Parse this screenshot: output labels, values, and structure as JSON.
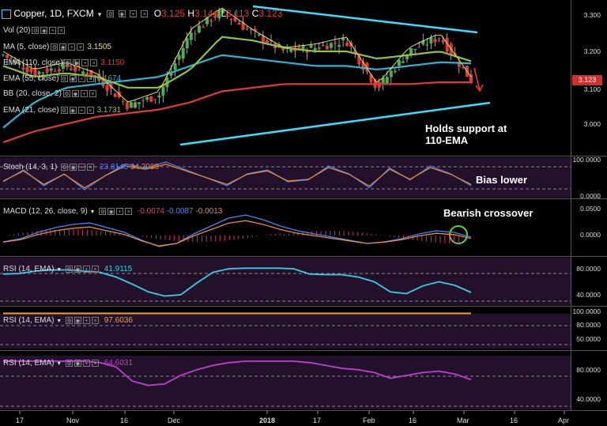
{
  "header": {
    "symbol": "Copper, 1D, FXCM",
    "open_label": "O",
    "open": "3.125",
    "high_label": "H",
    "high": "3.144",
    "low_label": "L",
    "low": "3.113",
    "close_label": "C",
    "close": "3.123"
  },
  "price_panel": {
    "indicators": [
      {
        "label": "Vol (20)",
        "value": "",
        "color": "#dddddd"
      },
      {
        "label": "MA (5, close)",
        "value": "3.1505",
        "color": "#e8e05a"
      },
      {
        "label": "EMA (110, close)",
        "value": "3.1150",
        "color": "#e53935"
      },
      {
        "label": "EMA (55, close)",
        "value": "3.1674",
        "color": "#29b6d6"
      },
      {
        "label": "BB (20, close, 2)",
        "value": "",
        "color": "#dddddd"
      },
      {
        "label": "EMA (21, close)",
        "value": "3.1731",
        "color": "#8bc34a"
      }
    ],
    "current_price": "3.123",
    "axis": [
      "3.300",
      "3.200",
      "3.100",
      "3.000"
    ]
  },
  "annotations": {
    "support": "Holds support at\n110-EMA",
    "bias": "Bias lower",
    "crossover": "Bearish crossover"
  },
  "stoch_panel": {
    "label": "Stoch (14, 3, 1)",
    "k": "23.8145",
    "d": "34.2038",
    "axis": [
      "100.0000",
      "0.0000"
    ]
  },
  "macd_panel": {
    "label": "MACD (12, 26, close, 9)",
    "hist": "-0.0074",
    "macd": "-0.0087",
    "signal": "-0.0013",
    "axis": [
      "0.0500",
      "0.0000"
    ]
  },
  "rsi_panels": [
    {
      "label": "RSI (14, EMA)",
      "value": "41.9115",
      "color": "#33d0e8",
      "axis": [
        "80.0000",
        "40.0000"
      ]
    },
    {
      "label": "RSI (14, EMA)",
      "value": "97.6036",
      "color": "#f0a030",
      "axis": [
        "100.0000",
        "80.0000",
        "50.0000"
      ]
    },
    {
      "label": "RSI (14, EMA)",
      "value": "64.6031",
      "color": "#c040d0",
      "axis": [
        "80.0000",
        "40.0000"
      ]
    }
  ],
  "x_axis": [
    "17",
    "Nov",
    "16",
    "Dec",
    "2018",
    "17",
    "Feb",
    "16",
    "Mar",
    "16",
    "Apr"
  ],
  "chart_data": {
    "type": "line",
    "title": "Copper, 1D, FXCM",
    "xlabel": "",
    "ylabel": "",
    "ylim": [
      2.95,
      3.33
    ],
    "x": [
      "17",
      "Nov",
      "16",
      "Dec",
      "2018",
      "17",
      "Feb",
      "16",
      "Mar"
    ],
    "series": [
      {
        "name": "Close",
        "values": [
          3.19,
          3.14,
          3.16,
          3.13,
          3.05,
          3.08,
          3.25,
          3.31,
          3.25,
          3.2,
          3.21,
          3.23,
          3.1,
          3.2,
          3.24,
          3.12
        ]
      },
      {
        "name": "EMA (55, close)",
        "values": [
          2.99,
          3.06,
          3.1,
          3.11,
          3.12,
          3.13,
          3.16,
          3.19,
          3.18,
          3.17,
          3.16,
          3.16,
          3.15,
          3.16,
          3.17,
          3.167
        ]
      },
      {
        "name": "EMA (110, close)",
        "values": [
          2.95,
          2.98,
          3.0,
          3.02,
          3.03,
          3.04,
          3.06,
          3.09,
          3.1,
          3.11,
          3.11,
          3.11,
          3.11,
          3.11,
          3.115,
          3.115
        ]
      },
      {
        "name": "EMA (21, close)",
        "values": [
          3.16,
          3.13,
          3.14,
          3.13,
          3.1,
          3.1,
          3.15,
          3.24,
          3.23,
          3.21,
          3.2,
          3.2,
          3.18,
          3.19,
          3.2,
          3.173
        ]
      }
    ],
    "trendlines": [
      {
        "name": "resistance",
        "from": [
          3.31
        ],
        "to": [
          3.26
        ]
      },
      {
        "name": "support",
        "from": [
          3.03
        ],
        "to": [
          3.06
        ]
      }
    ]
  }
}
